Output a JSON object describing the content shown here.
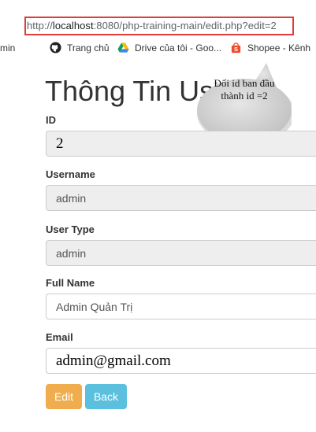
{
  "browser": {
    "url_prefix": "http://",
    "url_host": "localhost",
    "url_rest": ":8080/php-training-main/edit.php?edit=2",
    "bookmarks": [
      {
        "label": "min",
        "icon": "none"
      },
      {
        "label": "Trang chủ",
        "icon": "github-icon"
      },
      {
        "label": "Drive của tôi - Goo...",
        "icon": "google-drive-icon"
      },
      {
        "label": "Shopee - Kênh",
        "icon": "shopee-icon"
      }
    ]
  },
  "page": {
    "title": "Thông Tin Us"
  },
  "annotation": {
    "line1": "Đổi id ban đầu",
    "line2": "thành id =2"
  },
  "form": {
    "fields": [
      {
        "label": "ID",
        "value": "2"
      },
      {
        "label": "Username",
        "value": "admin"
      },
      {
        "label": "User Type",
        "value": "admin"
      },
      {
        "label": "Full Name",
        "value": "Admin Quản Trị"
      },
      {
        "label": "Email",
        "value": "admin@gmail.com"
      }
    ],
    "edit_label": "Edit",
    "back_label": "Back"
  },
  "colors": {
    "highlight": "#e03c3c",
    "edit_button": "#f0ad4e",
    "back_button": "#5bc0de",
    "bubble": "#d3d3d3"
  }
}
